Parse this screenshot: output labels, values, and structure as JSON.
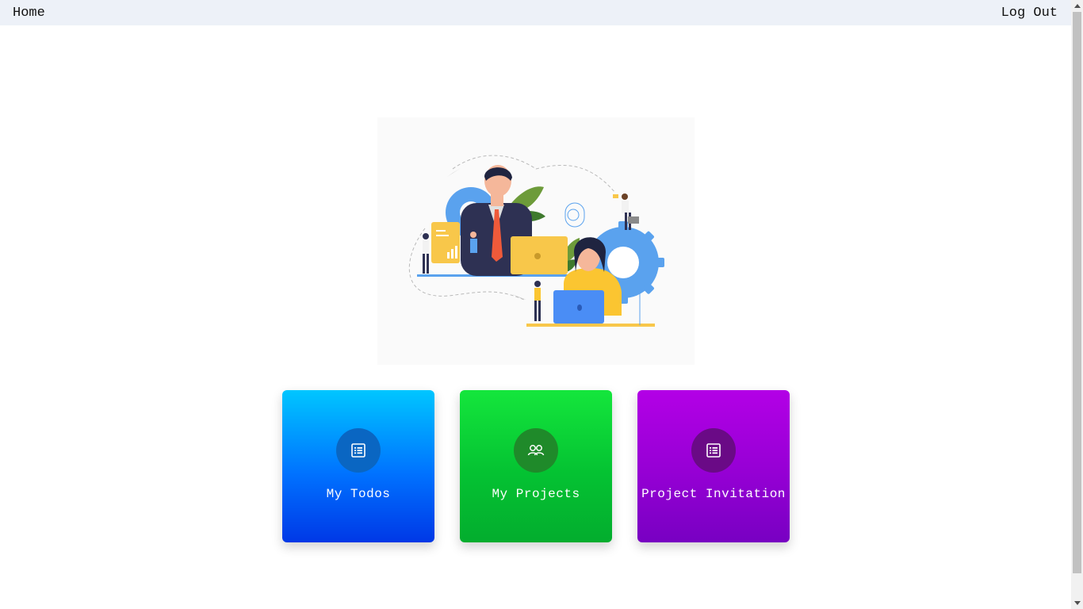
{
  "nav": {
    "home_label": "Home",
    "logout_label": "Log Out"
  },
  "cards": [
    {
      "label": "My Todos",
      "icon": "list-icon",
      "color": "#0072ff"
    },
    {
      "label": "My Projects",
      "icon": "users-icon",
      "color": "#04c232"
    },
    {
      "label": "Project Invitation",
      "icon": "list-icon",
      "color": "#9500d4"
    }
  ]
}
